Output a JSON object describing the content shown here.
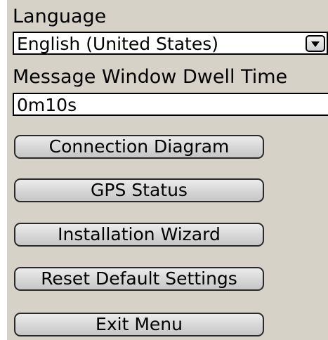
{
  "settings": {
    "language_label": "Language",
    "language_value": "English (United States)",
    "dwell_label": "Message Window Dwell Time",
    "dwell_value": "0m10s"
  },
  "buttons": {
    "connection_diagram": "Connection Diagram",
    "gps_status": "GPS Status",
    "installation_wizard": "Installation Wizard",
    "reset_defaults": "Reset Default Settings",
    "exit_menu": "Exit Menu"
  },
  "colors": {
    "panel_background": "#d6d2c8",
    "field_background": "#ffffff"
  },
  "icons": {
    "dropdown": "chevron-down-icon"
  }
}
